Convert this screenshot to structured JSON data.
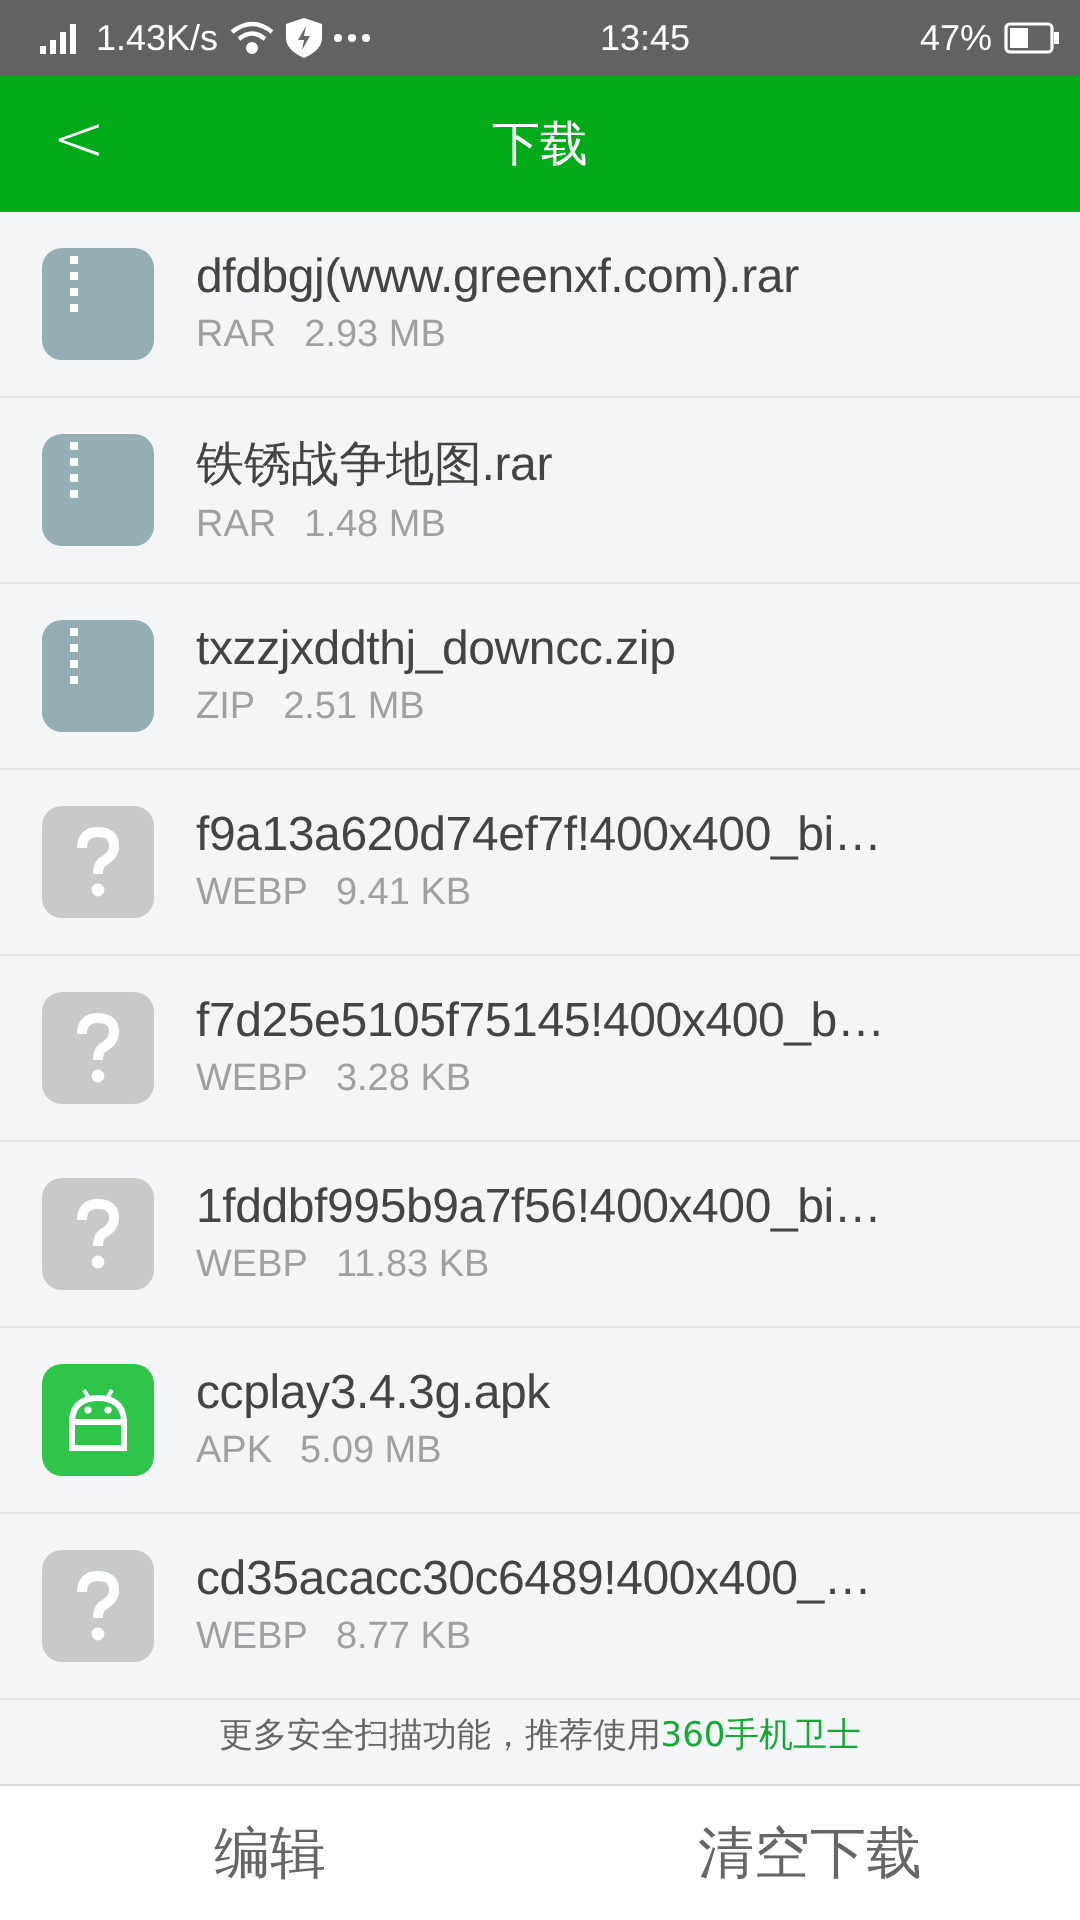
{
  "status_bar": {
    "speed": "1.43K/s",
    "time": "13:45",
    "battery": "47%"
  },
  "header": {
    "back": "<",
    "title": "下载"
  },
  "files": [
    {
      "kind": "archive",
      "name": "dfdbgj(www.greenxf.com).rar",
      "type": "RAR",
      "size": "2.93 MB"
    },
    {
      "kind": "archive",
      "name": "铁锈战争地图.rar",
      "type": "RAR",
      "size": "1.48 MB"
    },
    {
      "kind": "archive",
      "name": "txzzjxddthj_downcc.zip",
      "type": "ZIP",
      "size": "2.51 MB"
    },
    {
      "kind": "unknown",
      "name": "f9a13a620d74ef7f!400x400_bi…",
      "type": "WEBP",
      "size": "9.41 KB"
    },
    {
      "kind": "unknown",
      "name": "f7d25e5105f75145!400x400_b…",
      "type": "WEBP",
      "size": "3.28 KB"
    },
    {
      "kind": "unknown",
      "name": "1fddbf995b9a7f56!400x400_bi…",
      "type": "WEBP",
      "size": "11.83 KB"
    },
    {
      "kind": "apk",
      "name": "ccplay3.4.3g.apk",
      "type": "APK",
      "size": "5.09 MB"
    },
    {
      "kind": "unknown",
      "name": "cd35acacc30c6489!400x400_…",
      "type": "WEBP",
      "size": "8.77 KB"
    }
  ],
  "notice": {
    "text": "更多安全扫描功能，推荐使用",
    "link": "360手机卫士"
  },
  "bottom_buttons": [
    "编辑",
    "清空下载"
  ]
}
